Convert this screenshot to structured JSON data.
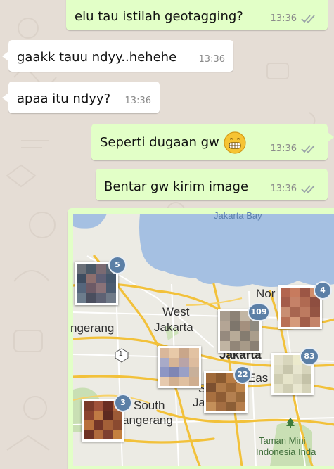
{
  "messages": [
    {
      "text": "elu tau istilah geotagging?",
      "time": "13:36"
    },
    {
      "text": "gaakk tauu ndyy..hehehe",
      "time": "13:36"
    },
    {
      "text": "apaa itu ndyy?",
      "time": "13:36"
    },
    {
      "text": "Seperti dugaan gw",
      "time": "13:36"
    },
    {
      "text": "Bentar gw kirim image",
      "time": "13:36"
    }
  ],
  "map": {
    "labels": {
      "bay": "Jakarta Bay",
      "west1": "West",
      "west2": "Jakarta",
      "north": "Nor",
      "jakarta": "Jakarta",
      "tang1": "ngerang",
      "south1": "South",
      "south2": "angerang",
      "east": "Eas",
      "ja": "Ja",
      "s": "S",
      "taman1": "Taman Mini",
      "taman2": "Indonesia Inda",
      "hw1": "1"
    },
    "clusters": [
      {
        "count": "5"
      },
      {
        "count": "109"
      },
      {
        "count": "4"
      },
      {
        "count": "83"
      },
      {
        "count": "22"
      },
      {
        "count": "3"
      }
    ]
  },
  "colors": {
    "background": "#e5ddd5",
    "incoming": "#ffffff",
    "outgoing": "#e2ffc7",
    "water": "#a5c0e2",
    "road": "#f2c13a",
    "badge": "#5b7fa6",
    "tick": "#9aa3a8"
  },
  "icons": [
    "double-check-icon",
    "grinning-face-emoji",
    "park-tree-icon"
  ]
}
